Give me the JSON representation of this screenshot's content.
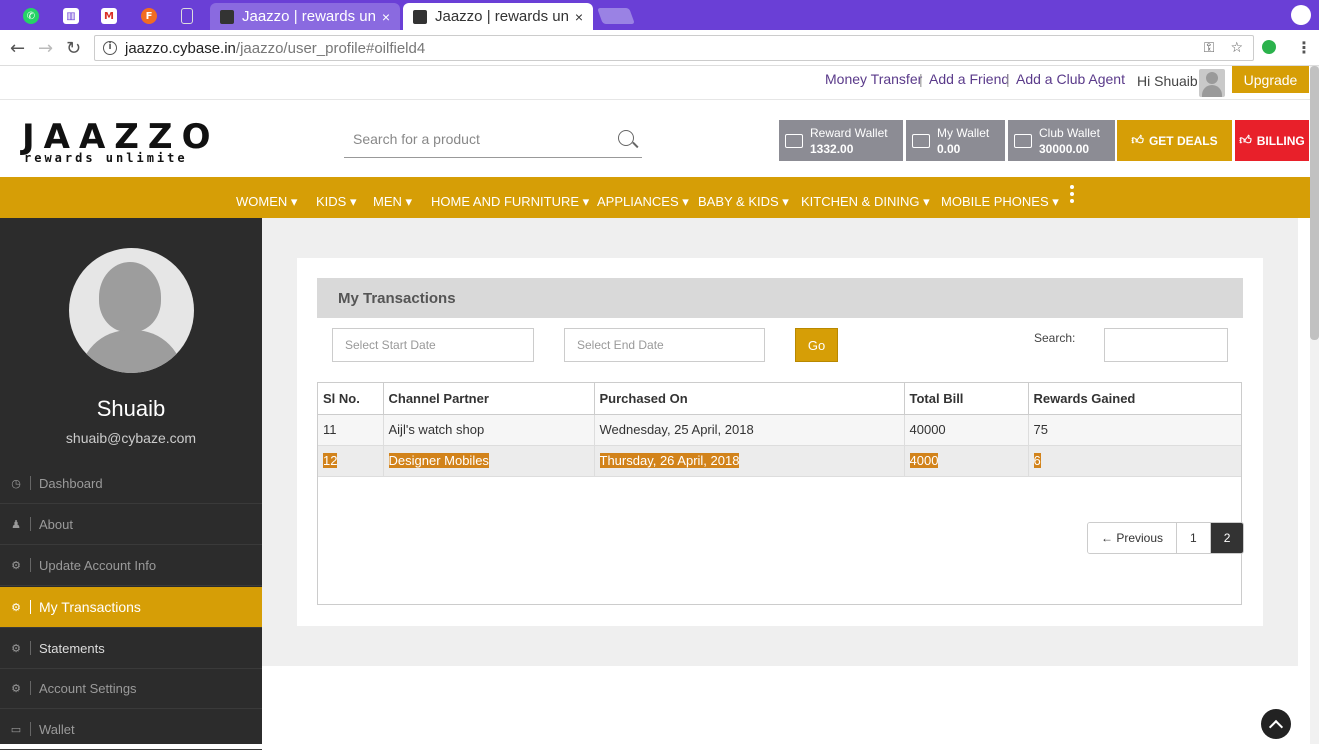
{
  "browser": {
    "tabs": [
      {
        "title": "Jaazzo | rewards un",
        "close": "×"
      },
      {
        "title": "Jaazzo | rewards un",
        "close": "×"
      }
    ],
    "url_host": "jaazzo.cybase.in",
    "url_path": "/jaazzo/user_profile#oilfield4",
    "url_info": "i",
    "ext_badge": "1"
  },
  "toplinks": {
    "money_transfer": "Money Transfer",
    "add_friend": "Add a Friend",
    "add_club_agent": "Add a Club Agent",
    "separator": "|",
    "greeting": "Hi Shuaib !",
    "upgrade": "Upgrade"
  },
  "header": {
    "logo_word": "JAAZZO",
    "logo_tag": "rewards unlimite",
    "search_placeholder": "Search for a product",
    "wallets": [
      {
        "label": "Reward Wallet",
        "value": "1332.00"
      },
      {
        "label": "My Wallet",
        "value": "0.00"
      },
      {
        "label": "Club Wallet",
        "value": "30000.00"
      }
    ],
    "get_deals": "GET DEALS",
    "billing": "BILLING"
  },
  "categories": [
    "WOMEN",
    "KIDS",
    "MEN",
    "HOME AND FURNITURE",
    "APPLIANCES",
    "BABY & KIDS",
    "KITCHEN & DINING",
    "MOBILE PHONES"
  ],
  "sidebar": {
    "name": "Shuaib",
    "email": "shuaib@cybaze.com",
    "items": [
      {
        "label": "Dashboard",
        "icon": "dashboard-icon"
      },
      {
        "label": "About",
        "icon": "user-icon"
      },
      {
        "label": "Update Account Info",
        "icon": "gear-icon"
      },
      {
        "label": "My Transactions",
        "icon": "gear-icon"
      },
      {
        "label": "Statements",
        "icon": "gear-icon"
      },
      {
        "label": "Account Settings",
        "icon": "gear-icon"
      },
      {
        "label": "Wallet",
        "icon": "wallet-icon"
      }
    ]
  },
  "transactions": {
    "title": "My Transactions",
    "start_placeholder": "Select Start Date",
    "end_placeholder": "Select End Date",
    "go": "Go",
    "search_label": "Search:",
    "columns": [
      "Sl No.",
      "Channel Partner",
      "Purchased On",
      "Total Bill",
      "Rewards Gained"
    ],
    "rows": [
      [
        "11",
        "Aijl's watch shop",
        "Wednesday, 25 April, 2018",
        "40000",
        "75"
      ],
      [
        "12",
        "Designer Mobiles",
        "Thursday, 26 April, 2018",
        "4000",
        "6"
      ]
    ],
    "pager": {
      "previous": "← Previous",
      "pages": [
        "1",
        "2"
      ],
      "current": "2"
    }
  },
  "colors": {
    "accent": "#d69e06",
    "billing": "#e8202a",
    "sidebar": "#2c2c2c",
    "chrome": "#6a3fd6"
  }
}
